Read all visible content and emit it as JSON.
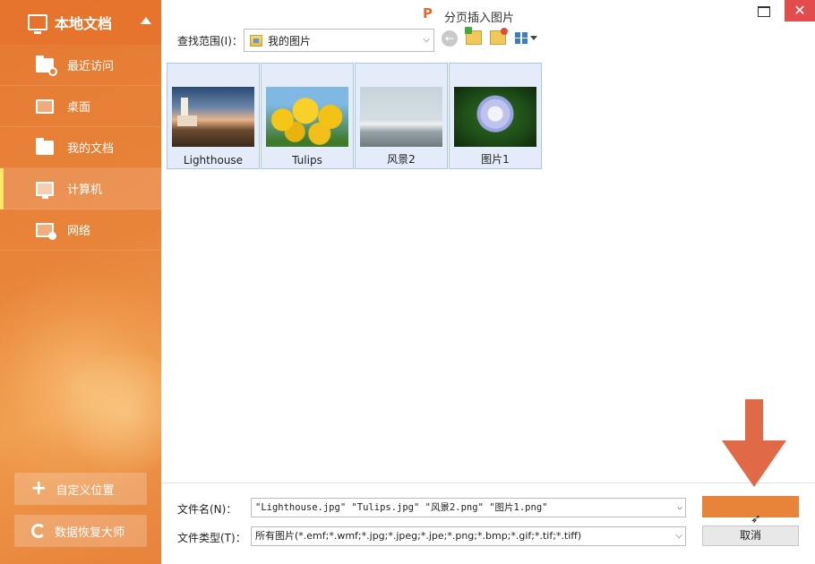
{
  "sidebar": {
    "title": "本地文档",
    "items": [
      {
        "label": "最近访问"
      },
      {
        "label": "桌面"
      },
      {
        "label": "我的文档"
      },
      {
        "label": "计算机"
      },
      {
        "label": "网络"
      }
    ],
    "active_item": "计算机",
    "custom_location_label": "自定义位置",
    "recovery_label": "数据恢复大师"
  },
  "window": {
    "title": "分页插入图片",
    "close_glyph": "✕"
  },
  "toolbar": {
    "lookin_label": "查找范围(I)：",
    "lookin_value": "我的图片"
  },
  "files": [
    {
      "name": "Lighthouse"
    },
    {
      "name": "Tulips"
    },
    {
      "name": "风景2"
    },
    {
      "name": "图片1"
    }
  ],
  "bottom": {
    "filename_label": "文件名(N)：",
    "filename_value": "\"Lighthouse.jpg\" \"Tulips.jpg\" \"风景2.png\" \"图片1.png\"",
    "filetype_label": "文件类型(T)：",
    "filetype_value": "所有图片(*.emf;*.wmf;*.jpg;*.jpeg;*.jpe;*.png;*.bmp;*.gif;*.tif;*.tiff)",
    "open_label": "",
    "cancel_label": "取消"
  },
  "colors": {
    "accent": "#e8843a",
    "close": "#e24c4c",
    "annotation_arrow": "#e06a47"
  }
}
